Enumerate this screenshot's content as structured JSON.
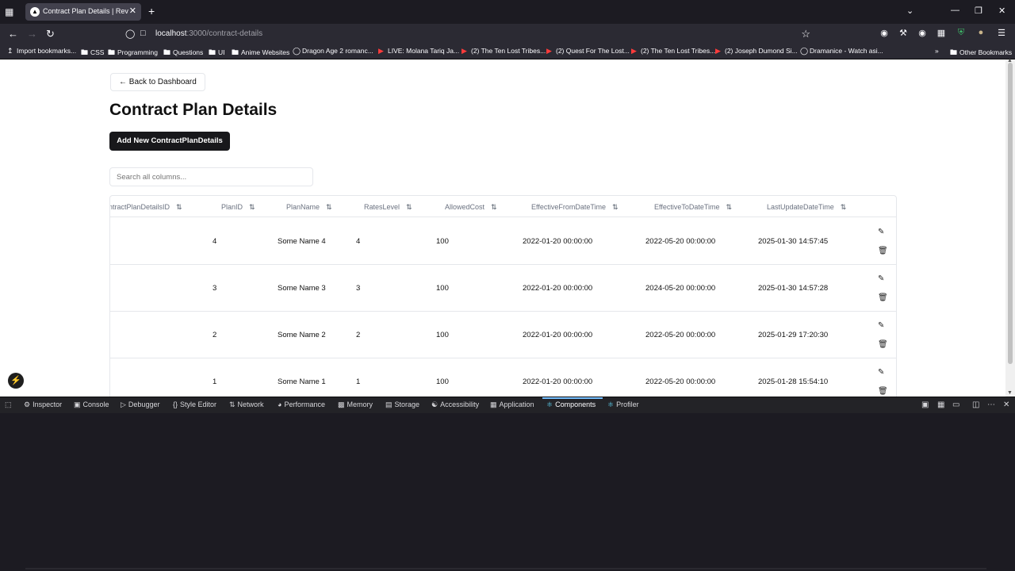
{
  "browser": {
    "tab_title": "Contract Plan Details | Revenue",
    "url_host": "localhost",
    "url_path": ":3000/contract-details",
    "bookmarks": [
      {
        "icon": "import-icon",
        "label": "Import bookmarks..."
      },
      {
        "icon": "folder-icon",
        "label": "CSS"
      },
      {
        "icon": "folder-icon",
        "label": "Programming"
      },
      {
        "icon": "folder-icon",
        "label": "Questions"
      },
      {
        "icon": "folder-icon",
        "label": "UI"
      },
      {
        "icon": "folder-icon",
        "label": "Anime Websites"
      },
      {
        "icon": "globe-icon",
        "label": "Dragon Age 2 romanc..."
      },
      {
        "icon": "youtube-icon",
        "label": "LIVE: Molana Tariq Ja..."
      },
      {
        "icon": "youtube-icon",
        "label": "(2) The Ten Lost Tribes..."
      },
      {
        "icon": "youtube-icon",
        "label": "(2) Quest For The Lost..."
      },
      {
        "icon": "youtube-icon",
        "label": "(2) The Ten Lost Tribes..."
      },
      {
        "icon": "youtube-icon",
        "label": "(2) Joseph Dumond Si..."
      },
      {
        "icon": "globe-icon",
        "label": "Dramanice - Watch asi..."
      }
    ],
    "other_bookmarks": "Other Bookmarks"
  },
  "page": {
    "back_label": "← Back to Dashboard",
    "title": "Contract Plan Details",
    "add_label": "Add New ContractPlanDetails",
    "search_placeholder": "Search all columns..."
  },
  "table": {
    "columns": [
      "ntractPlanDetailsID",
      "PlanID",
      "PlanName",
      "RatesLevel",
      "AllowedCost",
      "EffectiveFromDateTime",
      "EffectiveToDateTime",
      "LastUpdateDateTime"
    ],
    "rows": [
      {
        "plan_id": "4",
        "plan_name": "Some Name 4",
        "rates_level": "4",
        "allowed_cost": "100",
        "from": "2022-01-20 00:00:00",
        "to": "2022-05-20 00:00:00",
        "updated": "2025-01-30 14:57:45"
      },
      {
        "plan_id": "3",
        "plan_name": "Some Name 3",
        "rates_level": "3",
        "allowed_cost": "100",
        "from": "2022-01-20 00:00:00",
        "to": "2024-05-20 00:00:00",
        "updated": "2025-01-30 14:57:28"
      },
      {
        "plan_id": "2",
        "plan_name": "Some Name 2",
        "rates_level": "2",
        "allowed_cost": "100",
        "from": "2022-01-20 00:00:00",
        "to": "2022-05-20 00:00:00",
        "updated": "2025-01-29 17:20:30"
      },
      {
        "plan_id": "1",
        "plan_name": "Some Name 1",
        "rates_level": "1",
        "allowed_cost": "100",
        "from": "2022-01-20 00:00:00",
        "to": "2022-05-20 00:00:00",
        "updated": "2025-01-28 15:54:10"
      }
    ]
  },
  "devtools": {
    "tabs": [
      {
        "icon": "inspector-icon",
        "label": "Inspector"
      },
      {
        "icon": "console-icon",
        "label": "Console"
      },
      {
        "icon": "debugger-icon",
        "label": "Debugger"
      },
      {
        "icon": "style-editor-icon",
        "label": "Style Editor"
      },
      {
        "icon": "network-icon",
        "label": "Network"
      },
      {
        "icon": "performance-icon",
        "label": "Performance"
      },
      {
        "icon": "memory-icon",
        "label": "Memory"
      },
      {
        "icon": "storage-icon",
        "label": "Storage"
      },
      {
        "icon": "accessibility-icon",
        "label": "Accessibility"
      },
      {
        "icon": "application-icon",
        "label": "Application"
      },
      {
        "icon": "react-icon",
        "label": "Components"
      },
      {
        "icon": "react-icon",
        "label": "Profiler"
      }
    ],
    "active_tab": "Components"
  },
  "colors": {
    "primary_button": "#18181b",
    "devtools_active": "#75bfff",
    "youtube": "#ff3b3b"
  }
}
